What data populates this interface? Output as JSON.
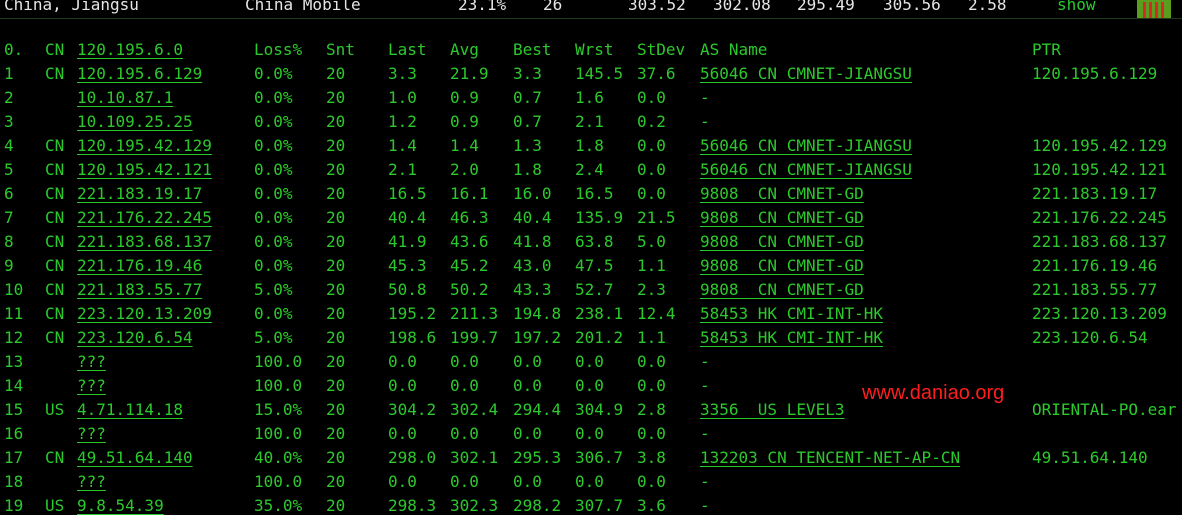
{
  "topbar": {
    "location": "China, Jiangsu",
    "isp": "China Mobile",
    "loss": "23.1%",
    "sent": "26",
    "last": "303.52",
    "avg": "302.08",
    "best": "295.49",
    "worst": "305.56",
    "stdev": "2.58",
    "show_label": "show",
    "spark_colors": {
      "bg": "#5a9e1f",
      "bar": "#d42a2a"
    }
  },
  "header": {
    "hop": "0.",
    "cc": "CN",
    "ip": "120.195.6.0",
    "loss": "Loss%",
    "snt": "Snt",
    "last": "Last",
    "avg": "Avg",
    "best": "Best",
    "wrst": "Wrst",
    "stdev": "StDev",
    "as": "AS Name",
    "ptr": "PTR"
  },
  "rows": [
    {
      "hop": "1",
      "cc": "CN",
      "ip": "120.195.6.129",
      "loss": "0.0%",
      "snt": "20",
      "last": "3.3",
      "avg": "21.9",
      "best": "3.3",
      "wrst": "145.5",
      "stdev": "37.6",
      "as": "56046 CN CMNET-JIANGSU",
      "ptr": "120.195.6.129"
    },
    {
      "hop": "2",
      "cc": "",
      "ip": "10.10.87.1",
      "loss": "0.0%",
      "snt": "20",
      "last": "1.0",
      "avg": "0.9",
      "best": "0.7",
      "wrst": "1.6",
      "stdev": "0.0",
      "as": "-",
      "ptr": ""
    },
    {
      "hop": "3",
      "cc": "",
      "ip": "10.109.25.25",
      "loss": "0.0%",
      "snt": "20",
      "last": "1.2",
      "avg": "0.9",
      "best": "0.7",
      "wrst": "2.1",
      "stdev": "0.2",
      "as": "-",
      "ptr": ""
    },
    {
      "hop": "4",
      "cc": "CN",
      "ip": "120.195.42.129",
      "loss": "0.0%",
      "snt": "20",
      "last": "1.4",
      "avg": "1.4",
      "best": "1.3",
      "wrst": "1.8",
      "stdev": "0.0",
      "as": "56046 CN CMNET-JIANGSU",
      "ptr": "120.195.42.129"
    },
    {
      "hop": "5",
      "cc": "CN",
      "ip": "120.195.42.121",
      "loss": "0.0%",
      "snt": "20",
      "last": "2.1",
      "avg": "2.0",
      "best": "1.8",
      "wrst": "2.4",
      "stdev": "0.0",
      "as": "56046 CN CMNET-JIANGSU",
      "ptr": "120.195.42.121"
    },
    {
      "hop": "6",
      "cc": "CN",
      "ip": "221.183.19.17",
      "loss": "0.0%",
      "snt": "20",
      "last": "16.5",
      "avg": "16.1",
      "best": "16.0",
      "wrst": "16.5",
      "stdev": "0.0",
      "as": "9808  CN CMNET-GD",
      "ptr": "221.183.19.17"
    },
    {
      "hop": "7",
      "cc": "CN",
      "ip": "221.176.22.245",
      "loss": "0.0%",
      "snt": "20",
      "last": "40.4",
      "avg": "46.3",
      "best": "40.4",
      "wrst": "135.9",
      "stdev": "21.5",
      "as": "9808  CN CMNET-GD",
      "ptr": "221.176.22.245"
    },
    {
      "hop": "8",
      "cc": "CN",
      "ip": "221.183.68.137",
      "loss": "0.0%",
      "snt": "20",
      "last": "41.9",
      "avg": "43.6",
      "best": "41.8",
      "wrst": "63.8",
      "stdev": "5.0",
      "as": "9808  CN CMNET-GD",
      "ptr": "221.183.68.137"
    },
    {
      "hop": "9",
      "cc": "CN",
      "ip": "221.176.19.46",
      "loss": "0.0%",
      "snt": "20",
      "last": "45.3",
      "avg": "45.2",
      "best": "43.0",
      "wrst": "47.5",
      "stdev": "1.1",
      "as": "9808  CN CMNET-GD",
      "ptr": "221.176.19.46"
    },
    {
      "hop": "10",
      "cc": "CN",
      "ip": "221.183.55.77",
      "loss": "5.0%",
      "snt": "20",
      "last": "50.8",
      "avg": "50.2",
      "best": "43.3",
      "wrst": "52.7",
      "stdev": "2.3",
      "as": "9808  CN CMNET-GD",
      "ptr": "221.183.55.77"
    },
    {
      "hop": "11",
      "cc": "CN",
      "ip": "223.120.13.209",
      "loss": "0.0%",
      "snt": "20",
      "last": "195.2",
      "avg": "211.3",
      "best": "194.8",
      "wrst": "238.1",
      "stdev": "12.4",
      "as": "58453 HK CMI-INT-HK",
      "ptr": "223.120.13.209"
    },
    {
      "hop": "12",
      "cc": "CN",
      "ip": "223.120.6.54",
      "loss": "5.0%",
      "snt": "20",
      "last": "198.6",
      "avg": "199.7",
      "best": "197.2",
      "wrst": "201.2",
      "stdev": "1.1",
      "as": "58453 HK CMI-INT-HK",
      "ptr": "223.120.6.54"
    },
    {
      "hop": "13",
      "cc": "",
      "ip": "???",
      "loss": "100.0",
      "snt": "20",
      "last": "0.0",
      "avg": "0.0",
      "best": "0.0",
      "wrst": "0.0",
      "stdev": "0.0",
      "as": "-",
      "ptr": ""
    },
    {
      "hop": "14",
      "cc": "",
      "ip": "???",
      "loss": "100.0",
      "snt": "20",
      "last": "0.0",
      "avg": "0.0",
      "best": "0.0",
      "wrst": "0.0",
      "stdev": "0.0",
      "as": "-",
      "ptr": ""
    },
    {
      "hop": "15",
      "cc": "US",
      "ip": "4.71.114.18",
      "loss": "15.0%",
      "snt": "20",
      "last": "304.2",
      "avg": "302.4",
      "best": "294.4",
      "wrst": "304.9",
      "stdev": "2.8",
      "as": "3356  US LEVEL3",
      "ptr": "ORIENTAL-PO.ear"
    },
    {
      "hop": "16",
      "cc": "",
      "ip": "???",
      "loss": "100.0",
      "snt": "20",
      "last": "0.0",
      "avg": "0.0",
      "best": "0.0",
      "wrst": "0.0",
      "stdev": "0.0",
      "as": "-",
      "ptr": ""
    },
    {
      "hop": "17",
      "cc": "CN",
      "ip": "49.51.64.140",
      "loss": "40.0%",
      "snt": "20",
      "last": "298.0",
      "avg": "302.1",
      "best": "295.3",
      "wrst": "306.7",
      "stdev": "3.8",
      "as": "132203 CN TENCENT-NET-AP-CN",
      "ptr": "49.51.64.140"
    },
    {
      "hop": "18",
      "cc": "",
      "ip": "???",
      "loss": "100.0",
      "snt": "20",
      "last": "0.0",
      "avg": "0.0",
      "best": "0.0",
      "wrst": "0.0",
      "stdev": "0.0",
      "as": "-",
      "ptr": ""
    },
    {
      "hop": "19",
      "cc": "US",
      "ip": "9.8.54.39",
      "loss": "35.0%",
      "snt": "20",
      "last": "298.3",
      "avg": "302.3",
      "best": "298.2",
      "wrst": "307.7",
      "stdev": "3.6",
      "as": "-",
      "ptr": ""
    }
  ],
  "watermark": "www.daniao.org",
  "colors": {
    "background": "#000000",
    "text": "#2cc92c",
    "topbar_text": "#e6e6e6",
    "watermark": "#ff1e1e"
  }
}
